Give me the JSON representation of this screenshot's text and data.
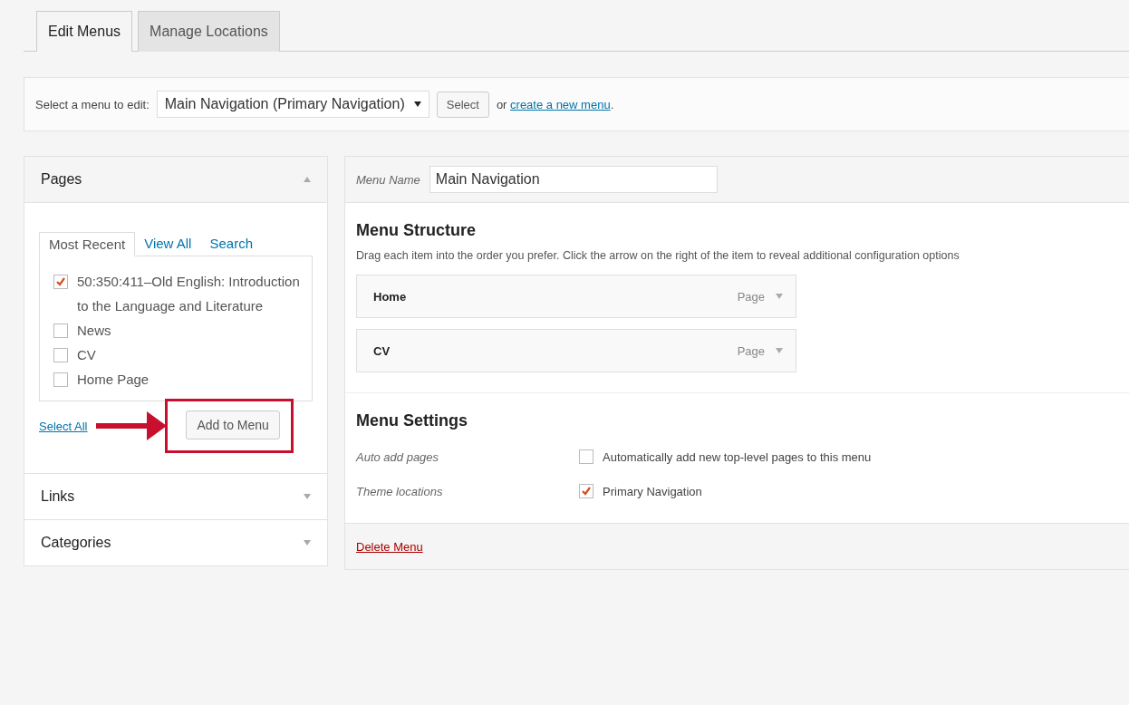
{
  "tabs": [
    {
      "label": "Edit Menus",
      "selected": true
    },
    {
      "label": "Manage Locations",
      "selected": false
    }
  ],
  "menu_select": {
    "label": "Select a menu to edit:",
    "value": "Main Navigation (Primary Navigation)",
    "button": "Select",
    "prefix": "or ",
    "link": "create a new menu",
    "suffix": "."
  },
  "sidebar": [
    {
      "title": "Pages",
      "expanded": true,
      "subtabs": [
        {
          "label": "Most Recent",
          "selected": true
        },
        {
          "label": "View All",
          "selected": false
        },
        {
          "label": "Search",
          "selected": false
        }
      ],
      "items": [
        {
          "label": "50:350:411–Old English: Introduction to the Language and Literature",
          "checked": true
        },
        {
          "label": "News",
          "checked": false
        },
        {
          "label": "CV",
          "checked": false
        },
        {
          "label": "Home Page",
          "checked": false
        }
      ],
      "select_all": "Select All",
      "add_button": "Add to Menu"
    },
    {
      "title": "Links",
      "expanded": false
    },
    {
      "title": "Categories",
      "expanded": false
    }
  ],
  "menu": {
    "name_label": "Menu Name",
    "name_value": "Main Navigation",
    "structure_title": "Menu Structure",
    "structure_hint": "Drag each item into the order you prefer. Click the arrow on the right of the item to reveal additional configuration options",
    "items": [
      {
        "title": "Home",
        "type": "Page"
      },
      {
        "title": "CV",
        "type": "Page"
      }
    ],
    "settings_title": "Menu Settings",
    "settings": [
      {
        "label": "Auto add pages",
        "text": "Automatically add new top-level pages to this menu",
        "checked": false
      },
      {
        "label": "Theme locations",
        "text": "Primary Navigation",
        "checked": true
      }
    ],
    "delete": "Delete Menu"
  }
}
